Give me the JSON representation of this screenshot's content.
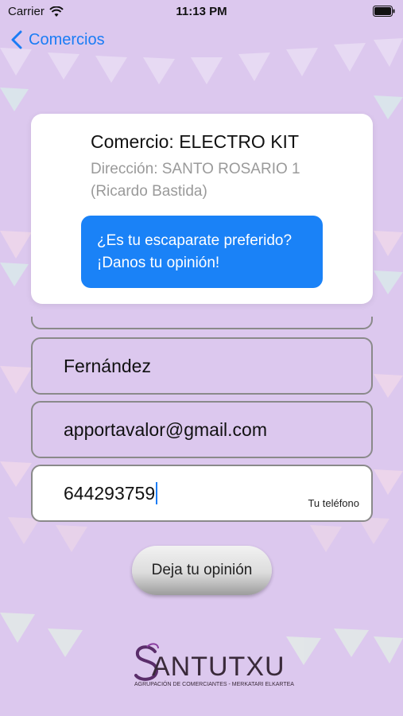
{
  "status_bar": {
    "carrier": "Carrier",
    "time": "11:13 PM"
  },
  "nav": {
    "back_label": "Comercios"
  },
  "shop_card": {
    "title": "Comercio: ELECTRO KIT",
    "address": "Dirección: SANTO ROSARIO 1 (Ricardo Bastida)",
    "cta_line1": "¿Es tu escaparate preferido?",
    "cta_line2": "¡Danos tu opinión!"
  },
  "form": {
    "surname_value": "Fernández",
    "email_value": "apportavalor@gmail.com",
    "phone_value": "644293759",
    "phone_hint": "Tu teléfono"
  },
  "submit_label": "Deja tu opinión",
  "logo": {
    "wordmark": "ANTUTXU",
    "tagline": "AGRUPACIÓN DE COMERCIANTES - MERKATARI ELKARTEA"
  },
  "colors": {
    "background": "#dcc8ee",
    "accent": "#1a82f7",
    "card": "#ffffff"
  }
}
